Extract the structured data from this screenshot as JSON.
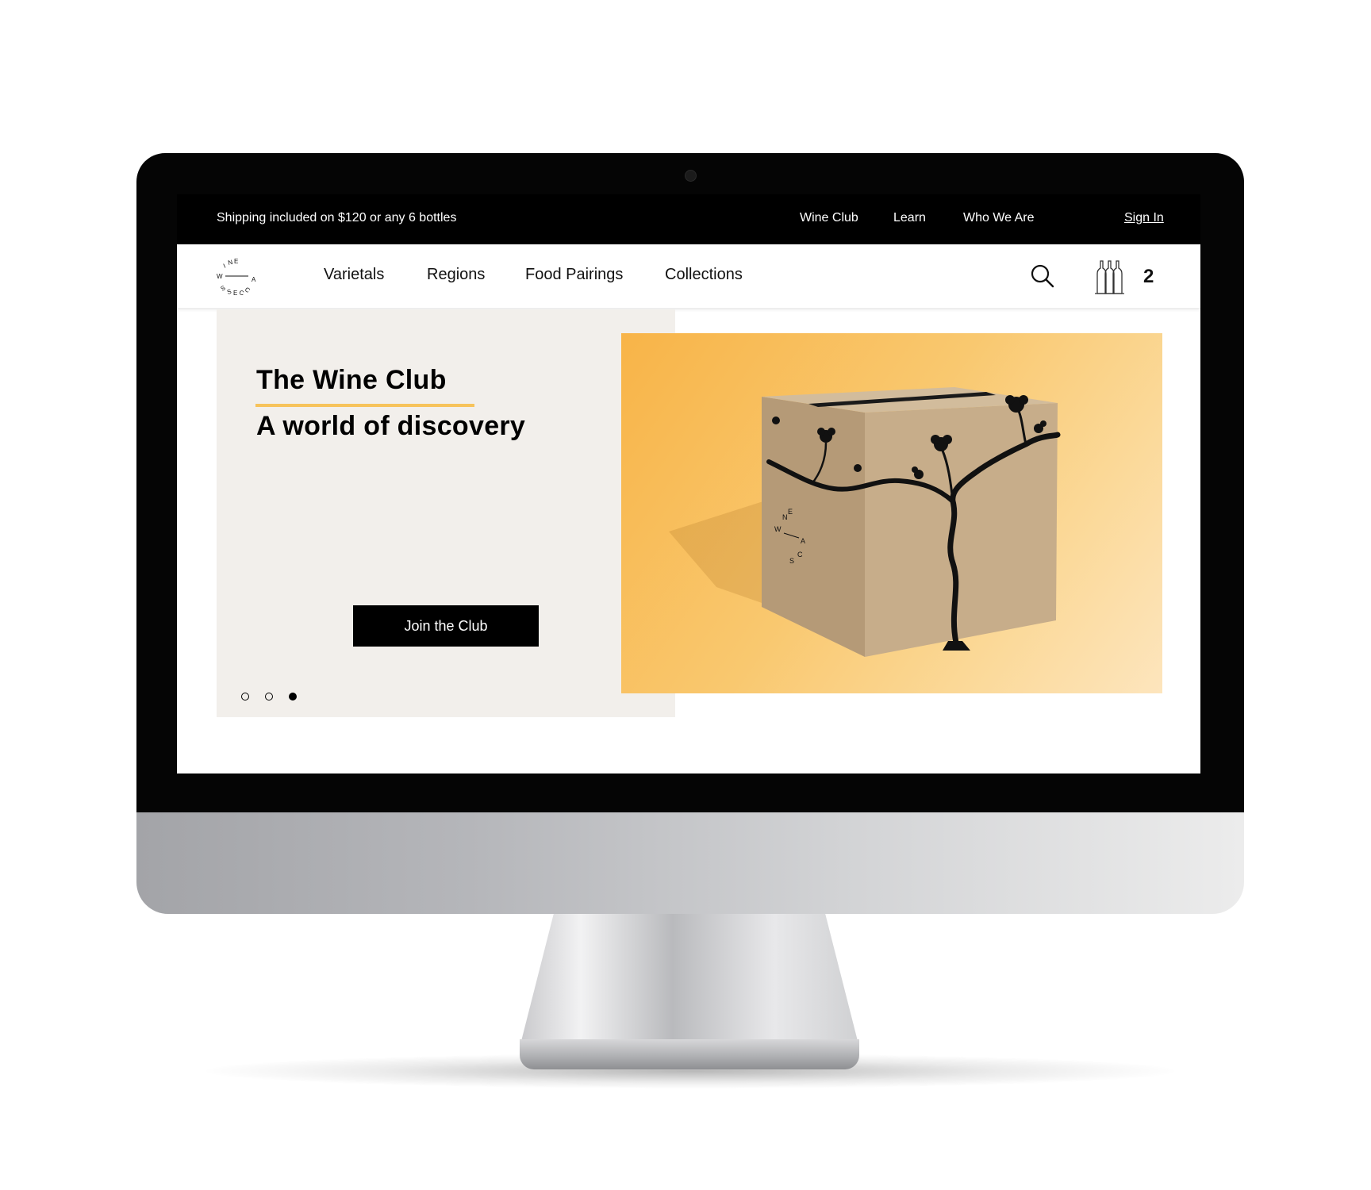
{
  "topbar": {
    "promo": "Shipping included on $120 or any 6 bottles",
    "links": [
      "Wine Club",
      "Learn",
      "Who We Are"
    ],
    "sign_in": "Sign In"
  },
  "nav": {
    "logo_icon": "wine-access-circular-logo",
    "items": [
      "Varietals",
      "Regions",
      "Food Pairings",
      "Collections"
    ],
    "search_icon": "search-icon",
    "cart_icon": "wine-bottles-icon",
    "cart_count": "2"
  },
  "hero": {
    "title": "The Wine Club",
    "subtitle": "A world of discovery",
    "cta": "Join the Club",
    "slides_total": 3,
    "active_slide": 3,
    "accent_color": "#f7c35b",
    "panel_color": "#f2efeb",
    "image_description_icon": "wine-box-with-vine-image"
  }
}
